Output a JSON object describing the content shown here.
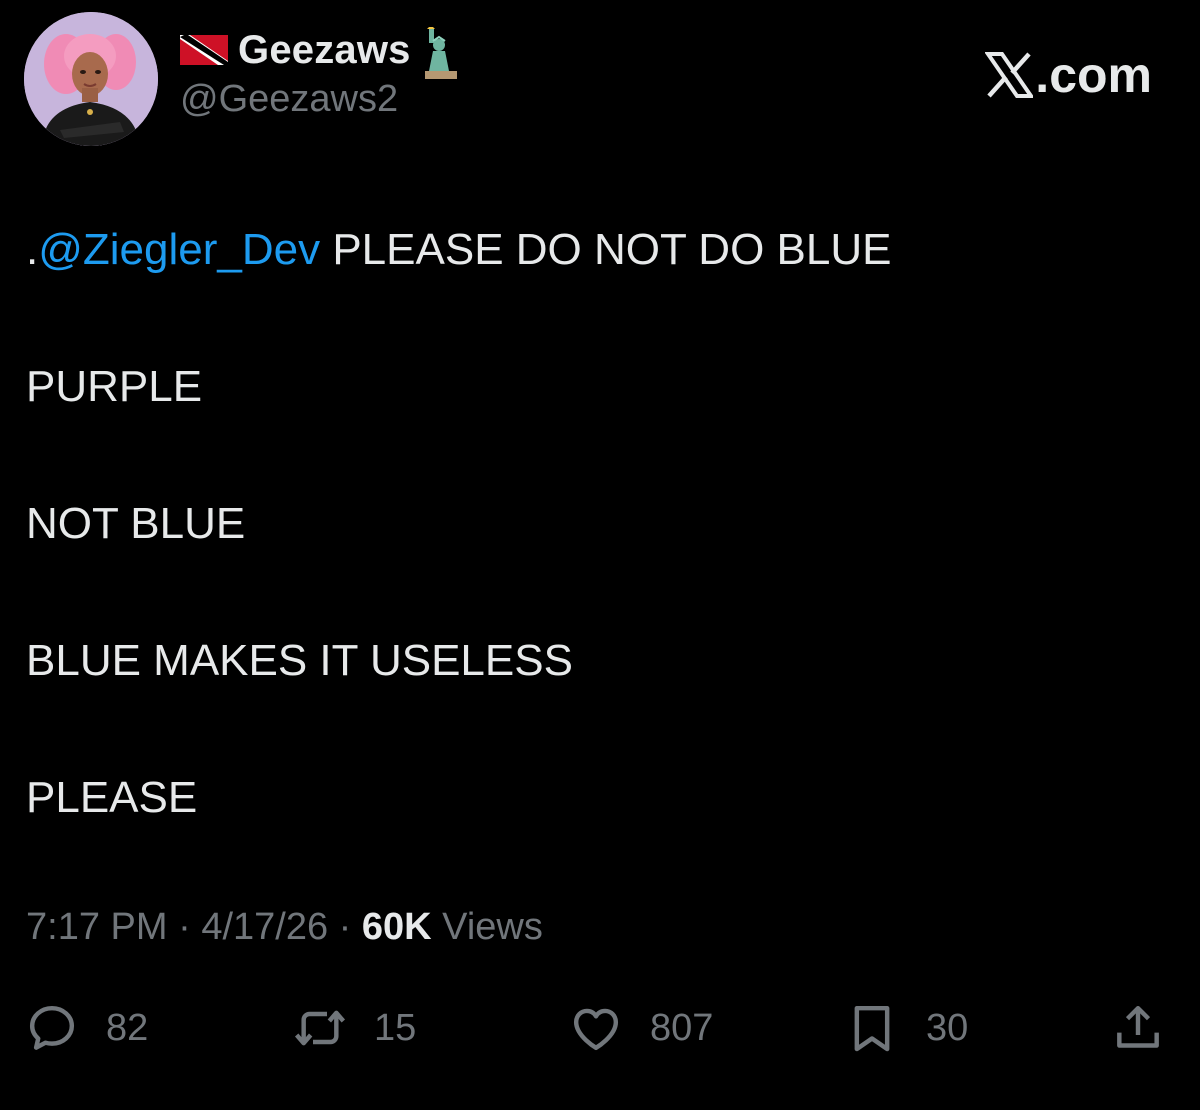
{
  "post": {
    "author": {
      "display_name": "Geezaws",
      "handle": "@Geezaws2",
      "flag_icon": "trinidad-tobago-flag-icon",
      "emoji_icon": "statue-of-liberty-icon"
    },
    "site_logo": {
      "mark": "𝕏",
      "text": ".com"
    },
    "body": {
      "mention_prefix": ".",
      "mention": "@Ziegler_Dev",
      "first_line_rest": " PLEASE DO NOT DO BLUE",
      "lines": [
        "PURPLE",
        "NOT BLUE",
        "BLUE MAKES IT USELESS",
        "PLEASE"
      ]
    },
    "meta": {
      "time": "7:17 PM",
      "separator": " · ",
      "date": "4/17/26",
      "views_count": "60K",
      "views_label": " Views"
    },
    "actions": {
      "replies": "82",
      "reposts": "15",
      "likes": "807",
      "bookmarks": "30"
    }
  },
  "colors": {
    "background": "#000000",
    "text": "#e7e9ea",
    "secondary": "#71767b",
    "mention": "#1d9bf0"
  }
}
